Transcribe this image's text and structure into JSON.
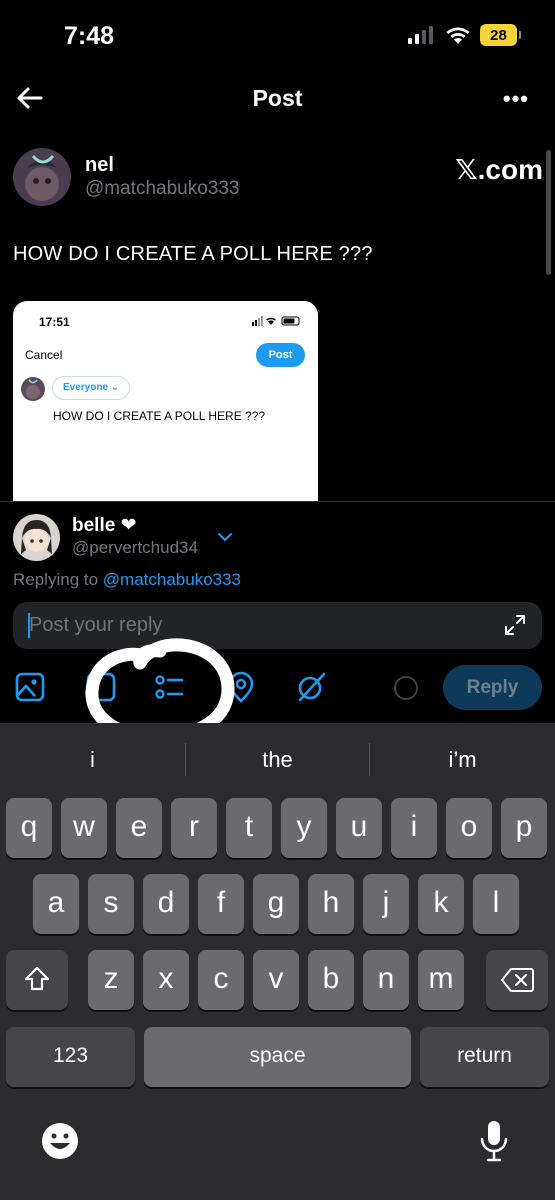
{
  "status_bar": {
    "time": "7:48",
    "battery": "28",
    "battery_color": "#f6d33a"
  },
  "header": {
    "title": "Post",
    "back_icon": "arrow-left-icon",
    "more_icon": "more-horizontal-icon",
    "more_label": "•••"
  },
  "post": {
    "author_name": "nel",
    "author_handle": "@matchabuko333",
    "source_logo": "𝕏.com",
    "text": "HOW DO I CREATE A POLL HERE ???",
    "image": {
      "time": "17:51",
      "cancel_label": "Cancel",
      "post_label": "Post",
      "audience_label": "Everyone ⌄",
      "compose_text": "HOW DO I CREATE A POLL HERE ???"
    }
  },
  "reply": {
    "account_name": "belle ❤",
    "account_handle": "@pervertchud34",
    "replying_to_label": "Replying to ",
    "replying_to_handle": "@matchabuko333",
    "input_placeholder": "Post your reply",
    "input_value": "",
    "tools": [
      "image-icon",
      "gif-icon",
      "poll-icon",
      "location-icon",
      "grok-icon"
    ],
    "reply_button": "Reply",
    "accent_color": "#1d9bf0"
  },
  "keyboard": {
    "suggestions": [
      "i",
      "the",
      "i’m"
    ],
    "row1": [
      "q",
      "w",
      "e",
      "r",
      "t",
      "y",
      "u",
      "i",
      "o",
      "p"
    ],
    "row2": [
      "a",
      "s",
      "d",
      "f",
      "g",
      "h",
      "j",
      "k",
      "l"
    ],
    "row3": [
      "z",
      "x",
      "c",
      "v",
      "b",
      "n",
      "m"
    ],
    "numbers_label": "123",
    "space_label": "space",
    "return_label": "return",
    "emoji_icon": "emoji-icon",
    "dictation_icon": "microphone-icon"
  }
}
